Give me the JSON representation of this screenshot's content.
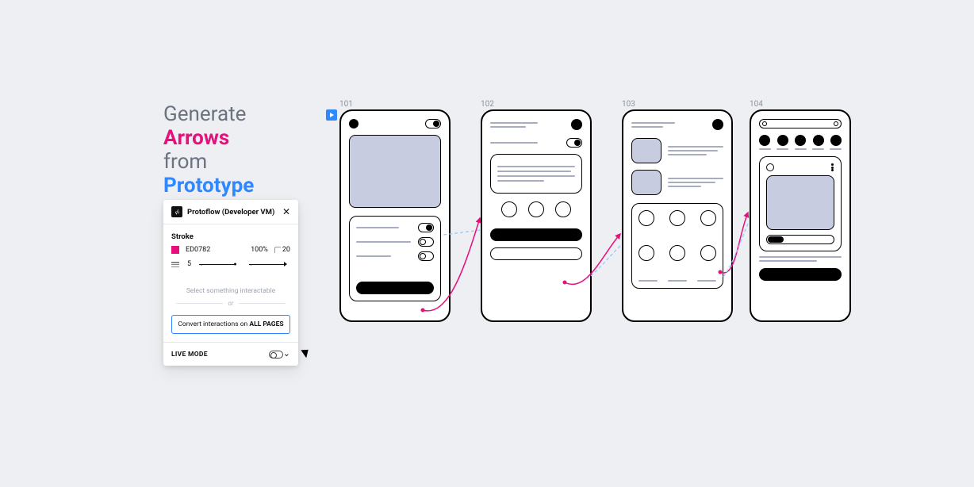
{
  "headline": {
    "w1": "Generate",
    "w2": "Arrows",
    "w3": "from",
    "w4": "Prototype"
  },
  "panel": {
    "title": "Protoflow (Developer VM)",
    "stroke_label": "Stroke",
    "hex": "ED0782",
    "opacity": "100%",
    "radius": "20",
    "thickness": "5",
    "hint": "Select something interactable",
    "or": "or",
    "convert_prefix": "Convert interactions on ",
    "convert_bold": "ALL PAGES",
    "live_mode": "LIVE MODE"
  },
  "frames": {
    "f1": "101",
    "f2": "102",
    "f3": "103",
    "f4": "104"
  },
  "colors": {
    "pink": "#e60f7c",
    "blue": "#2f88ff",
    "lilac": "#c7cce0"
  }
}
